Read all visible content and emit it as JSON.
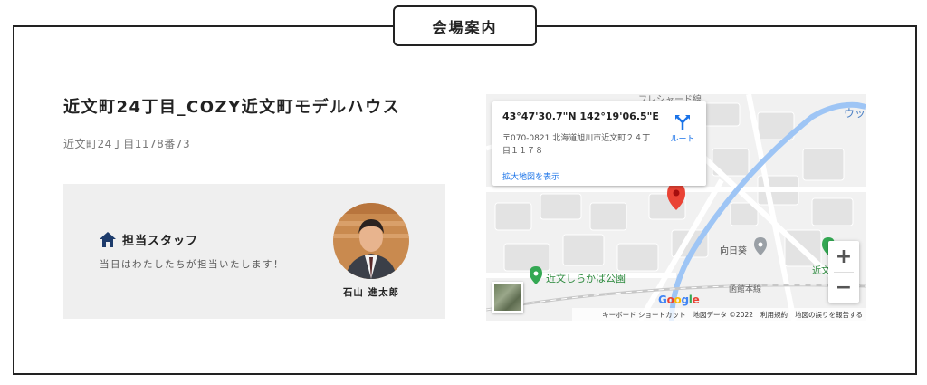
{
  "section": {
    "label": "会場案内"
  },
  "venue": {
    "title": "近文町24丁目_COZY近文町モデルハウス",
    "address": "近文町24丁目1178番73"
  },
  "staff": {
    "heading": "担当スタッフ",
    "description": "当日はわたしたちが担当いたします！",
    "name": "石山 進太郎"
  },
  "map": {
    "coords": "43°47'30.7\"N 142°19'06.5\"E",
    "address": "〒070-0821 北海道旭川市近文町２４丁目１１７８",
    "route_label": "ルート",
    "enlarge_label": "拡大地図を表示",
    "labels": {
      "top_partial": "フレシャード線",
      "top_right_partial": "ウッ",
      "himawari": "向日葵",
      "park": "近文しらかば公園",
      "right_partial": "近文",
      "railway": "函館本線"
    },
    "zoom_in": "+",
    "zoom_out": "−",
    "google": "Google",
    "footer": {
      "shortcuts": "キーボード ショートカット",
      "map_data": "地図データ ©2022",
      "terms": "利用規約",
      "report": "地図の誤りを報告する"
    }
  },
  "colors": {
    "border": "#222222",
    "staff_bg": "#efefef",
    "link": "#1a73e8",
    "river": "#9ec5f5",
    "pin": "#ea4335",
    "park_green": "#34a853",
    "icon_navy": "#1d3b6b"
  }
}
